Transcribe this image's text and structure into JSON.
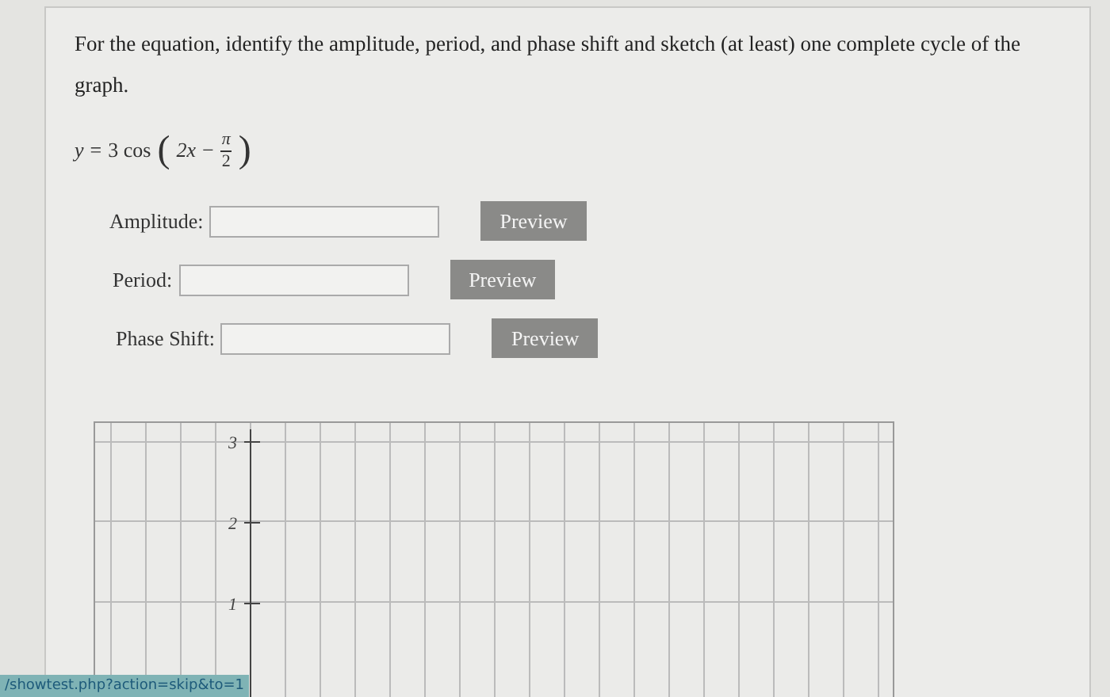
{
  "question": {
    "prompt": "For the equation, identify the amplitude, period, and phase shift and sketch (at least) one complete cycle of the graph.",
    "equation": {
      "lhs": "y",
      "eq": "=",
      "coef": "3 cos",
      "open": "(",
      "close": ")",
      "arg": "2x",
      "minus": "−",
      "num": "π",
      "den": "2"
    }
  },
  "fields": [
    {
      "label": "Amplitude:",
      "button": "Preview"
    },
    {
      "label": "Period:",
      "button": "Preview"
    },
    {
      "label": "Phase Shift:",
      "button": "Preview"
    }
  ],
  "graph": {
    "y_labels": [
      "3",
      "2",
      "1"
    ]
  },
  "status_link": "/showtest.php?action=skip&to=1"
}
